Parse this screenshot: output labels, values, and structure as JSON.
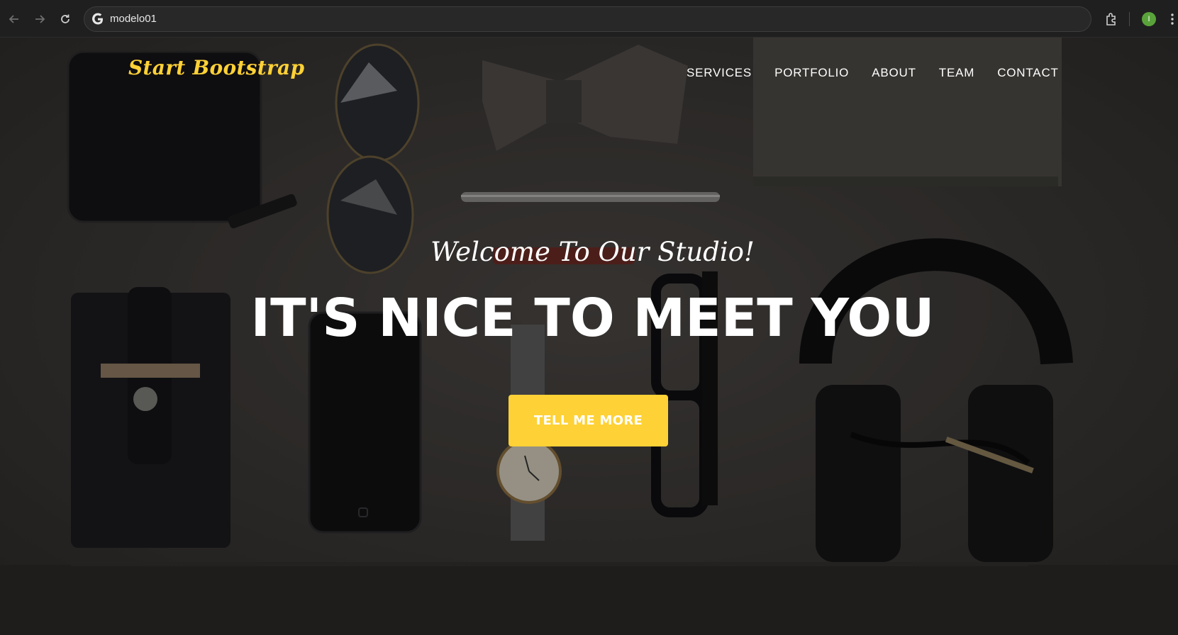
{
  "browser": {
    "url": "modelo01",
    "profile_initial": "I",
    "icons": [
      "back-arrow-icon",
      "forward-arrow-icon",
      "reload-icon",
      "google-icon",
      "extensions-icon",
      "kebab-menu-icon"
    ]
  },
  "header": {
    "brand": "Start Bootstrap",
    "nav": [
      "SERVICES",
      "PORTFOLIO",
      "ABOUT",
      "TEAM",
      "CONTACT"
    ]
  },
  "hero": {
    "subheading": "Welcome To Our Studio!",
    "heading": "IT'S NICE TO MEET YOU",
    "button_label": "TELL ME MORE"
  },
  "colors": {
    "accent": "#fed136",
    "profile": "#5aa33b"
  }
}
